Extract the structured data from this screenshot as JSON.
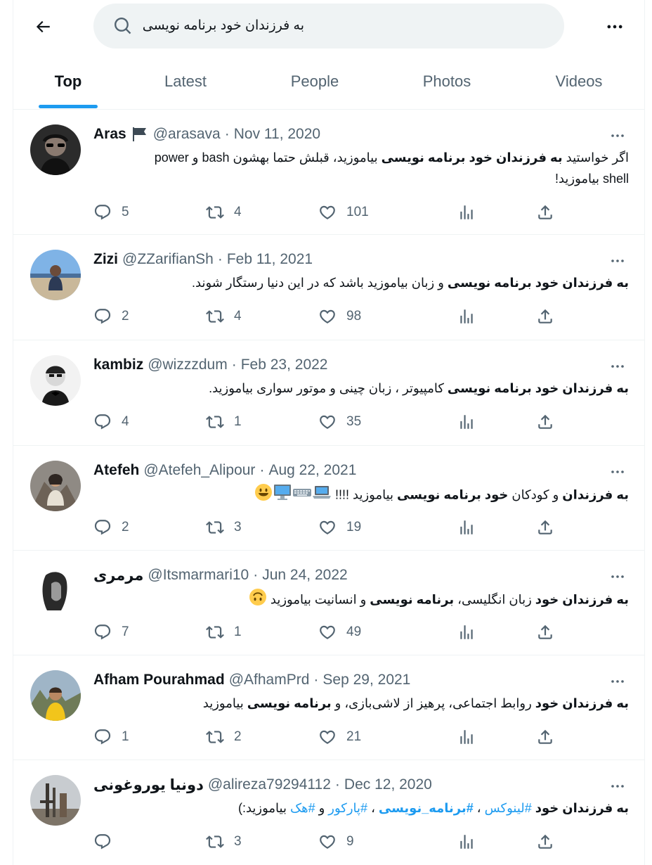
{
  "search": {
    "query": "به فرزندان خود برنامه نویسی"
  },
  "tabs": [
    "Top",
    "Latest",
    "People",
    "Photos",
    "Videos"
  ],
  "tweets": [
    {
      "name": "Aras",
      "handle": "@arasava",
      "date": "Nov 11, 2020",
      "body_parts": [
        "اگر خواستید ",
        "به فرزندان خود برنامه نویسی",
        " بیاموزید، قبلش حتما بهشون bash و  power shell بیاموزید!"
      ],
      "replies": "5",
      "retweets": "4",
      "likes": "101"
    },
    {
      "name": "Zizi",
      "handle": "@ZZarifianSh",
      "date": "Feb 11, 2021",
      "body_parts": [
        "به فرزندان خود برنامه نویسی",
        " و زبان بیاموزید باشد که در این دنیا رستگار شوند."
      ],
      "replies": "2",
      "retweets": "4",
      "likes": "98"
    },
    {
      "name": "kambiz",
      "handle": "@wizzzdum",
      "date": "Feb 23, 2022",
      "body_parts": [
        "به فرزندان خود برنامه نویسی",
        " کامپیوتر ، زبان چینی و موتور سواری بیاموزید."
      ],
      "replies": "4",
      "retweets": "1",
      "likes": "35"
    },
    {
      "name": "Atefeh",
      "handle": "@Atefeh_Alipour",
      "date": "Aug 22, 2021",
      "body_parts": [
        "به فرزندان",
        " و کودکان ",
        "خود برنامه نویسی",
        " بیاموزید !!!!"
      ],
      "replies": "2",
      "retweets": "3",
      "likes": "19"
    },
    {
      "name": "مرمری",
      "handle": "@Itsmarmari10",
      "date": "Jun 24, 2022",
      "body_parts": [
        "به فرزندان خود",
        " زبان انگلیسی، ",
        "برنامه نویسی",
        " و انسانیت بیاموزید"
      ],
      "replies": "7",
      "retweets": "1",
      "likes": "49"
    },
    {
      "name": "Afham Pourahmad",
      "handle": "@AfhamPrd",
      "date": "Sep 29, 2021",
      "body_parts": [
        "به فرزندان خود",
        " روابط اجتماعی، پرهیز از لاشی‌بازی، و ",
        "برنامه نویسی",
        " بیاموزید"
      ],
      "replies": "1",
      "retweets": "2",
      "likes": "21"
    },
    {
      "name": "دونیا یوروغونی",
      "handle": "@alireza79294112",
      "date": "Dec 12, 2020",
      "body_parts": [
        "به فرزندان خود",
        " ",
        "#لینوکس",
        " ، ",
        "#برنامه_نویسی",
        " ، ",
        "#پارکور",
        " و ",
        "#هک",
        " بیاموزید:)"
      ],
      "replies": "",
      "retweets": "3",
      "likes": "9"
    }
  ],
  "colors": {
    "accent": "#1d9bf0",
    "muted": "#536471",
    "text": "#0f1419"
  }
}
